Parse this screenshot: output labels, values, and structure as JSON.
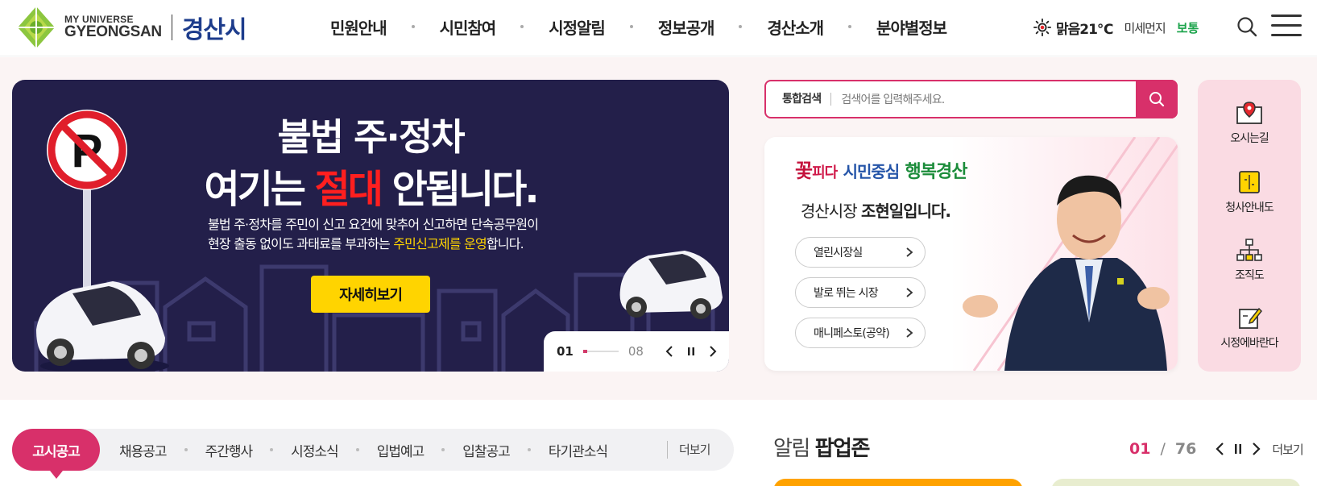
{
  "header": {
    "logo_small": "MY UNIVERSE",
    "logo_big": "GYEONGSAN",
    "logo_kor": "경산시",
    "nav": [
      "민원안내",
      "시민참여",
      "시정알림",
      "정보공개",
      "경산소개",
      "분야별정보"
    ],
    "weather": {
      "icon": "sun-icon",
      "text": "맑음21℃",
      "dust_label": "미세먼지",
      "dust_value": "보통",
      "dust_color": "#1aa34a"
    }
  },
  "banner": {
    "title1": "불법 주·정차",
    "title2_a": "여기는 ",
    "title2_red": "절대",
    "title2_b": " 안됩니다.",
    "desc_line1": "불법 주·정차를 주민이 신고 요건에 맞추어 신고하면 단속공무원이",
    "desc_line2_a": "현장 출동 없이도 과태료를 부과하는 ",
    "desc_line2_hl": "주민신고제를 운영",
    "desc_line2_b": "합니다.",
    "button": "자세히보기",
    "current": "01",
    "total": "08",
    "progress": 0.125
  },
  "search": {
    "label": "통합검색",
    "placeholder": "검색어를 입력해주세요."
  },
  "mayor": {
    "slogan_a": "꽃",
    "slogan_b": "피다",
    "slogan_c": "시민중심",
    "slogan_d": "행복경산",
    "name_prefix": "경산시장 ",
    "name": "조현일입니다.",
    "links": [
      "열린시장실",
      "발로 뛰는 시장",
      "매니페스토(공약)"
    ]
  },
  "quick": [
    "오시는길",
    "청사안내도",
    "조직도",
    "시정에바란다"
  ],
  "board": {
    "active_tab": "고시공고",
    "tabs": [
      "채용공고",
      "주간행사",
      "시정소식",
      "입법예고",
      "입찰공고",
      "타기관소식"
    ],
    "more": "더보기"
  },
  "popup": {
    "title_a": "알림 ",
    "title_b": "팝업존",
    "current": "01",
    "sep": "/",
    "total": "76",
    "more": "더보기"
  },
  "colors": {
    "accent": "#d8306a",
    "banner_bg": "#231f4a",
    "highlight": "#ffd400",
    "quick_bg": "#fadbe3"
  }
}
